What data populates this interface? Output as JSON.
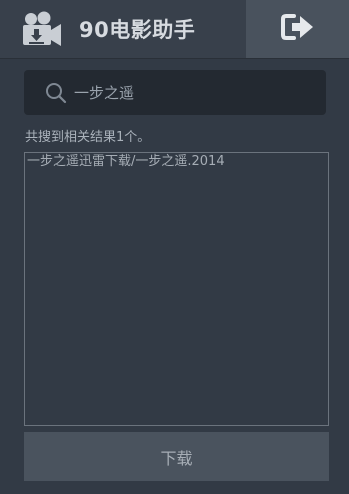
{
  "header": {
    "title": "90电影助手",
    "app_icon": "video-camera-download-icon",
    "exit_icon": "sign-out-icon"
  },
  "search": {
    "value": "一步之遥",
    "icon": "search-icon"
  },
  "results": {
    "summary": "共搜到相关结果1个。",
    "items": [
      {
        "label": "一步之遥迅雷下载/一步之遥.2014"
      }
    ]
  },
  "actions": {
    "download_label": "下载"
  },
  "colors": {
    "background": "#323a45",
    "header": "#38404b",
    "exit_button": "#49525d",
    "search_box": "#232931",
    "download_button": "#4a535e"
  }
}
